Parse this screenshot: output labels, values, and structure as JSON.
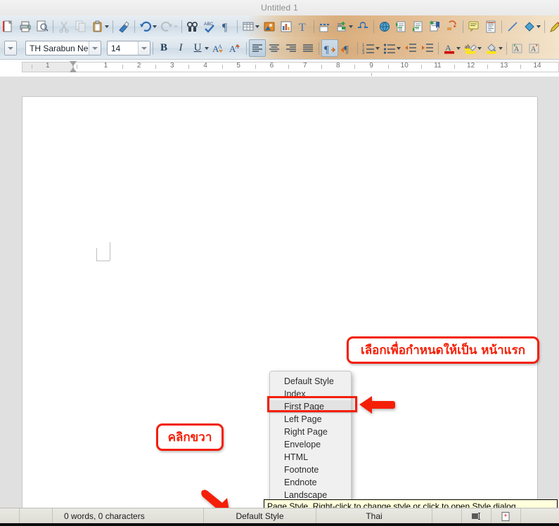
{
  "window": {
    "title": "Untitled 1"
  },
  "standard_toolbar": {
    "items": [
      {
        "name": "new-doc-icon",
        "label": "New",
        "enabled": true,
        "has_dropdown": false
      },
      {
        "name": "print-icon",
        "label": "Print",
        "enabled": true,
        "has_dropdown": false
      },
      {
        "name": "print-preview-icon",
        "label": "Print Preview",
        "enabled": true,
        "has_dropdown": false
      },
      {
        "name": "cut-icon",
        "label": "Cut",
        "enabled": false,
        "has_dropdown": false
      },
      {
        "name": "copy-icon",
        "label": "Copy",
        "enabled": false,
        "has_dropdown": false
      },
      {
        "name": "paste-icon",
        "label": "Paste",
        "enabled": true,
        "has_dropdown": true
      },
      {
        "name": "clone-formatting-icon",
        "label": "Clone Formatting",
        "enabled": true,
        "has_dropdown": false
      },
      {
        "name": "undo-icon",
        "label": "Undo",
        "enabled": true,
        "has_dropdown": true
      },
      {
        "name": "redo-icon",
        "label": "Redo",
        "enabled": false,
        "has_dropdown": true
      },
      {
        "name": "find-replace-icon",
        "label": "Find and Replace",
        "enabled": true,
        "has_dropdown": false
      },
      {
        "name": "spelling-icon",
        "label": "Spelling",
        "enabled": true,
        "has_dropdown": false
      },
      {
        "name": "formatting-marks-icon",
        "label": "Formatting Marks",
        "enabled": true,
        "has_dropdown": false
      },
      {
        "name": "insert-table-icon",
        "label": "Insert Table",
        "enabled": true,
        "has_dropdown": true
      },
      {
        "name": "insert-image-icon",
        "label": "Insert Image",
        "enabled": true,
        "has_dropdown": false
      },
      {
        "name": "insert-chart-icon",
        "label": "Insert Chart",
        "enabled": true,
        "has_dropdown": false
      },
      {
        "name": "insert-text-box-icon",
        "label": "Insert Text Box",
        "enabled": true,
        "has_dropdown": false
      },
      {
        "name": "page-break-icon",
        "label": "Insert Page Break",
        "enabled": true,
        "has_dropdown": false
      },
      {
        "name": "insert-field-icon",
        "label": "Insert Field",
        "enabled": true,
        "has_dropdown": true
      },
      {
        "name": "special-character-icon",
        "label": "Insert Special Character",
        "enabled": true,
        "has_dropdown": false
      },
      {
        "name": "hyperlink-icon",
        "label": "Insert Hyperlink",
        "enabled": true,
        "has_dropdown": false
      },
      {
        "name": "footnote-icon",
        "label": "Insert Footnote",
        "enabled": true,
        "has_dropdown": false
      },
      {
        "name": "endnote-icon",
        "label": "Insert Endnote",
        "enabled": true,
        "has_dropdown": false
      },
      {
        "name": "bookmark-icon",
        "label": "Insert Bookmark",
        "enabled": true,
        "has_dropdown": false
      },
      {
        "name": "cross-reference-icon",
        "label": "Insert Cross-reference",
        "enabled": true,
        "has_dropdown": false
      },
      {
        "name": "comment-icon",
        "label": "Insert Comment",
        "enabled": true,
        "has_dropdown": false
      },
      {
        "name": "track-changes-icon",
        "label": "Track Changes",
        "enabled": true,
        "has_dropdown": false
      },
      {
        "name": "line-icon",
        "label": "Insert Line",
        "enabled": true,
        "has_dropdown": false
      },
      {
        "name": "basic-shapes-icon",
        "label": "Basic Shapes",
        "enabled": true,
        "has_dropdown": true
      },
      {
        "name": "show-draw-functions-icon",
        "label": "Show Draw Functions",
        "enabled": true,
        "has_dropdown": false
      }
    ]
  },
  "formatting_toolbar": {
    "paragraph_style": "",
    "font_name": "TH Sarabun Ne",
    "font_size": "14",
    "buttons": [
      {
        "name": "bold-button",
        "label": "B",
        "active": false
      },
      {
        "name": "italic-button",
        "label": "I",
        "active": false
      },
      {
        "name": "underline-button",
        "label": "U",
        "active": false
      },
      {
        "name": "increase-font-size-button",
        "label": "A",
        "active": false
      },
      {
        "name": "decrease-font-size-button",
        "label": "A",
        "active": false
      },
      {
        "name": "align-left-button",
        "label": "Align Left",
        "active": true
      },
      {
        "name": "align-center-button",
        "label": "Align Center",
        "active": false
      },
      {
        "name": "align-right-button",
        "label": "Align Right",
        "active": false
      },
      {
        "name": "justify-button",
        "label": "Justified",
        "active": false
      },
      {
        "name": "ltr-paragraph-button",
        "label": "Left-To-Right",
        "active": true
      },
      {
        "name": "rtl-paragraph-button",
        "label": "Right-To-Left",
        "active": false
      },
      {
        "name": "ordered-list-button",
        "label": "Ordered List",
        "active": false
      },
      {
        "name": "unordered-list-button",
        "label": "Unordered List",
        "active": false
      },
      {
        "name": "decrease-indent-button",
        "label": "Decrease Indent",
        "active": false
      },
      {
        "name": "increase-indent-button",
        "label": "Increase Indent",
        "active": false
      },
      {
        "name": "font-color-button",
        "label": "Font Color",
        "active": false
      },
      {
        "name": "highlight-color-button",
        "label": "Highlighting Color",
        "active": false
      },
      {
        "name": "background-color-button",
        "label": "Background Color",
        "active": false
      },
      {
        "name": "complex-text-a-button",
        "label": "CTL A",
        "active": false
      },
      {
        "name": "complex-text-b-button",
        "label": "CTL B",
        "active": false
      }
    ]
  },
  "ruler": {
    "unit_ticks": [
      "1",
      "1",
      "2",
      "3",
      "4",
      "5",
      "6",
      "7",
      "8",
      "9",
      "10",
      "11",
      "12",
      "13",
      "14"
    ]
  },
  "context_menu": {
    "items": [
      {
        "label": "Default Style",
        "selected": false
      },
      {
        "label": "Index",
        "selected": false
      },
      {
        "label": "First Page",
        "selected": true
      },
      {
        "label": "Left Page",
        "selected": false
      },
      {
        "label": "Right Page",
        "selected": false
      },
      {
        "label": "Envelope",
        "selected": false
      },
      {
        "label": "HTML",
        "selected": false
      },
      {
        "label": "Footnote",
        "selected": false
      },
      {
        "label": "Endnote",
        "selected": false
      },
      {
        "label": "Landscape",
        "selected": false
      }
    ]
  },
  "tooltip": {
    "text": "Page Style. Right-click to change style or click to open Style dialog."
  },
  "annotations": {
    "callout_select_first_page": "เลือกเพื่อกำหนดให้เป็น หน้าแรก",
    "callout_right_click": "คลิกขวา",
    "color": "#f41f06"
  },
  "status_bar": {
    "word_count": "0 words, 0 characters",
    "page_style": "Default Style",
    "language": "Thai",
    "selection_mode_icon": "selection-mode-icon",
    "unsaved_changes_icon": "document-modified-icon"
  }
}
